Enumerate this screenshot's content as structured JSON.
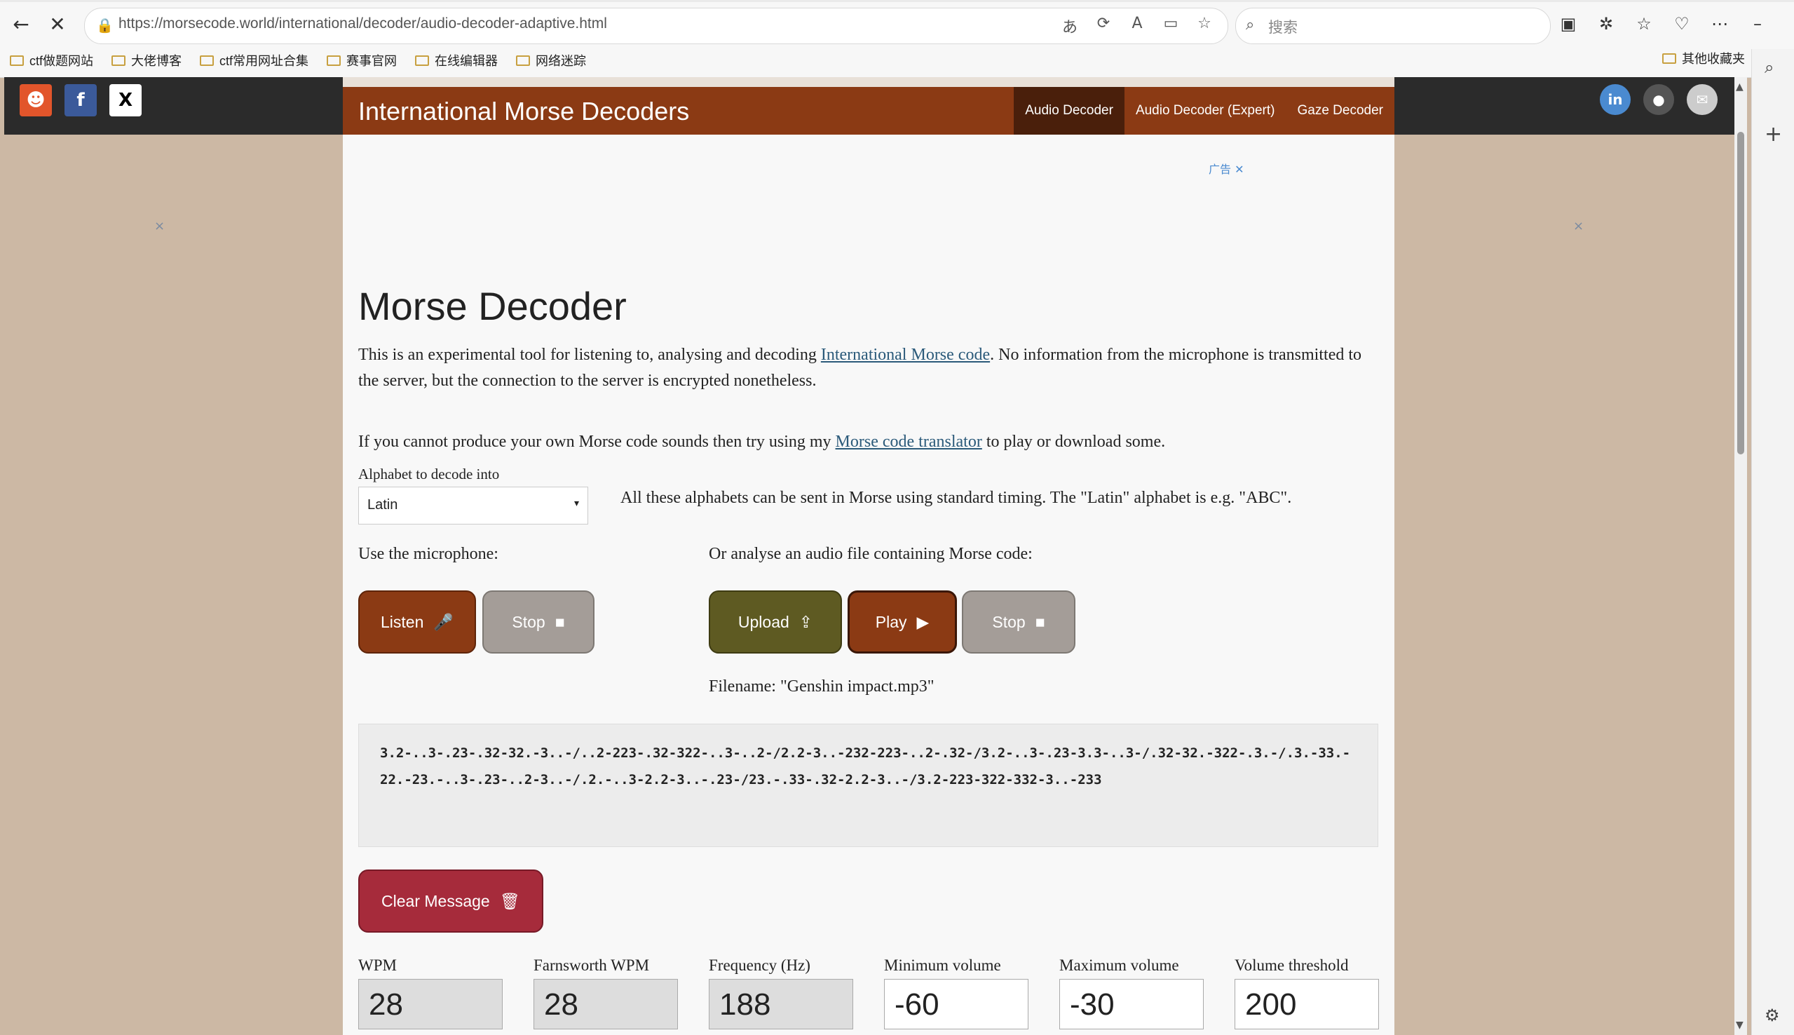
{
  "browser": {
    "url": "https://morsecode.world/international/decoder/audio-decoder-adaptive.html",
    "search_placeholder": "搜索",
    "bookmarks": [
      "ctf做题网站",
      "大佬博客",
      "ctf常用网址合集",
      "赛事官网",
      "在线编辑器",
      "网络迷踪"
    ],
    "bookmark_other": "其他收藏夹"
  },
  "site": {
    "title": "International Morse Decoders",
    "nav": [
      "Audio Decoder",
      "Audio Decoder (Expert)",
      "Gaze Decoder"
    ],
    "ad_label": "广告",
    "ad_close": "✕"
  },
  "main": {
    "heading": "Morse Decoder",
    "intro_before": "This is an experimental tool for listening to, analysing and decoding ",
    "intro_link": "International Morse code",
    "intro_after": ". No information from the microphone is transmitted to the server, but the connection to the server is encrypted nonetheless.",
    "translator_before": "If you cannot produce your own Morse code sounds then try using my ",
    "translator_link": "Morse code translator",
    "translator_after": " to play or download some.",
    "alphabet_label": "Alphabet to decode into",
    "alphabet_value": "Latin",
    "alphabet_note": "All these alphabets can be sent in Morse using standard timing. The \"Latin\" alphabet is e.g. \"ABC\".",
    "mic_label": "Use the microphone:",
    "file_label": "Or analyse an audio file containing Morse code:",
    "listen_label": "Listen",
    "stop_label": "Stop",
    "upload_label": "Upload",
    "play_label": "Play",
    "filename": "Filename: \"Genshin impact.mp3\"",
    "output": "3.2-..3-.23-.32-32.-3..-/..2-223-.32-322-..3-..2-/2.2-3..-232-223-..2-.32-/3.2-..3-.23-3.3-..3-/.32-32.-322-.3.-/.3.-33.-22.-23.-..3-.23-..2-3..-/.2.-..3-2.2-3..-.23-/23.-.33-.32-2.2-3..-/3.2-223-322-332-3..-233",
    "clear_label": "Clear Message",
    "fields": [
      {
        "label": "WPM",
        "value": "28"
      },
      {
        "label": "Farnsworth WPM",
        "value": "28"
      },
      {
        "label": "Frequency (Hz)",
        "value": "188"
      },
      {
        "label": "Minimum volume",
        "value": "-60"
      },
      {
        "label": "Maximum volume",
        "value": "-30"
      },
      {
        "label": "Volume threshold",
        "value": "200"
      }
    ]
  }
}
